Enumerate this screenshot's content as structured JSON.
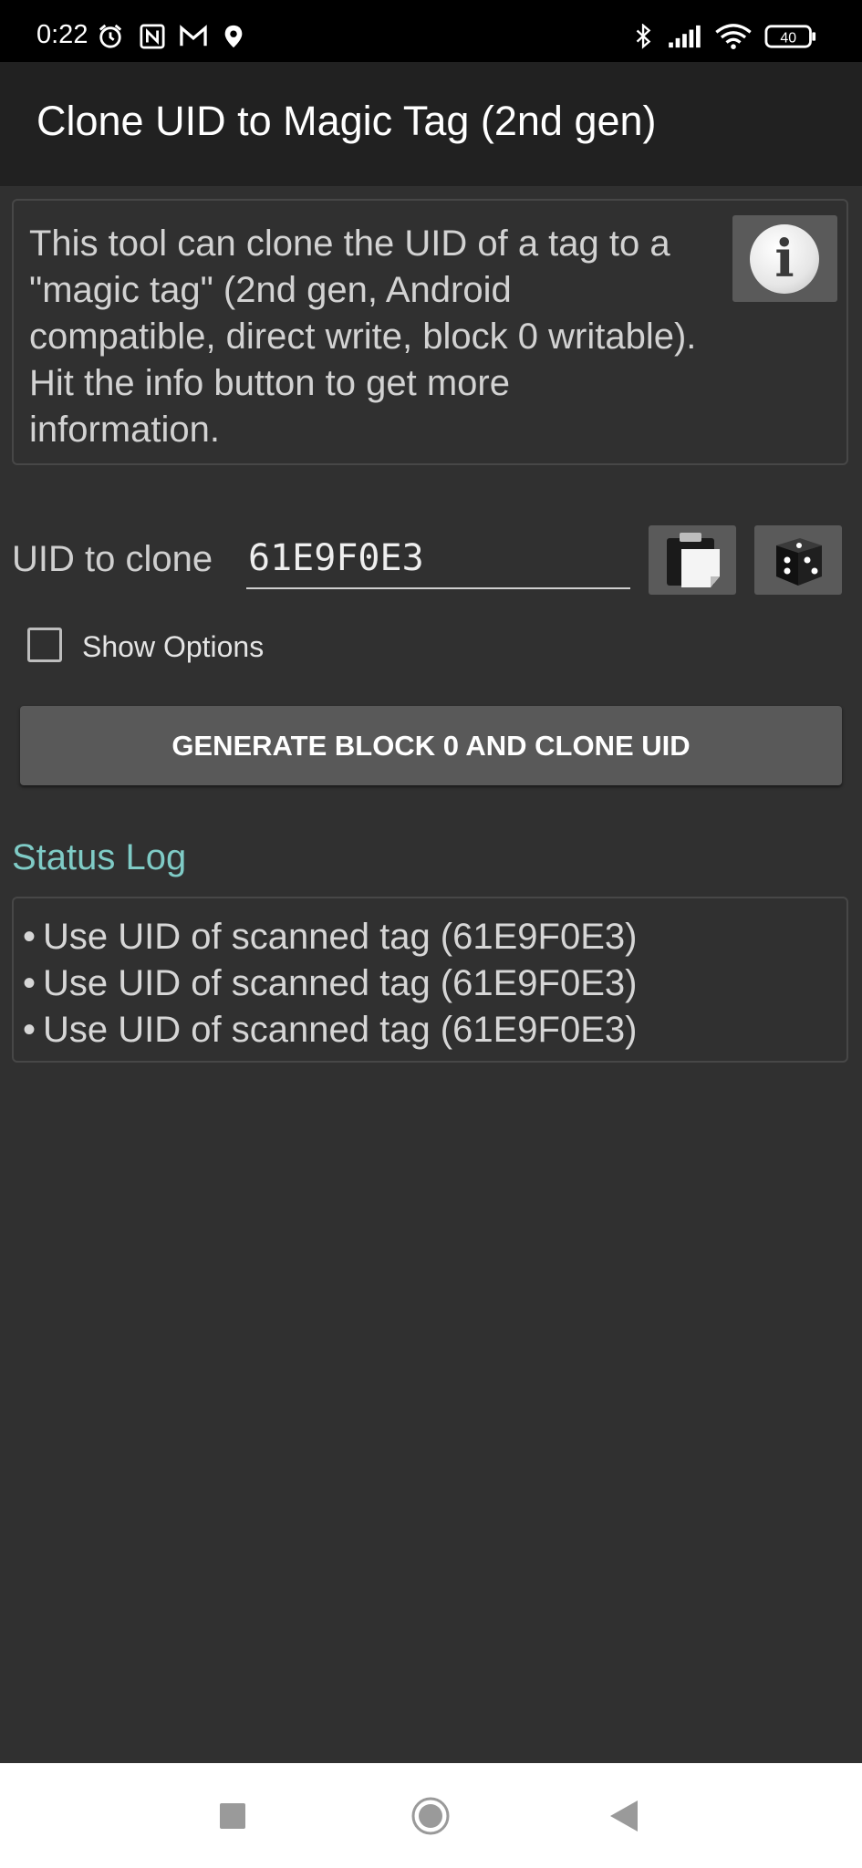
{
  "status_bar": {
    "time": "0:22",
    "battery": "40",
    "icons": [
      "alarm-icon",
      "nfc-icon",
      "gmail-icon",
      "location-icon",
      "bluetooth-icon",
      "signal-icon",
      "wifi-icon",
      "battery-icon"
    ]
  },
  "app_bar": {
    "title": "Clone UID to Magic Tag (2nd gen)"
  },
  "info": {
    "text": "This tool can clone the UID of a tag to a \"magic tag\" (2nd gen, Android compatible, direct write, block 0 writable). Hit the info button to get more information.",
    "button_icon": "info-icon",
    "button_glyph": "i"
  },
  "uid": {
    "label": "UID to clone",
    "value": "61E9F0E3",
    "paste_icon": "paste-clipboard-icon",
    "random_icon": "dice-icon"
  },
  "options": {
    "show_options_label": "Show Options",
    "checked": false
  },
  "generate_button": {
    "label": "GENERATE BLOCK 0 AND CLONE UID"
  },
  "status_log": {
    "title": "Status Log",
    "entries": [
      "Use UID of scanned tag (61E9F0E3)",
      "Use UID of scanned tag (61E9F0E3)",
      "Use UID of scanned tag (61E9F0E3)"
    ]
  },
  "colors": {
    "background": "#303030",
    "app_bar": "#212121",
    "accent": "#7fcbc6",
    "button": "#595959"
  },
  "nav_bar": {
    "icons": [
      "recents-icon",
      "home-icon",
      "back-icon"
    ]
  }
}
